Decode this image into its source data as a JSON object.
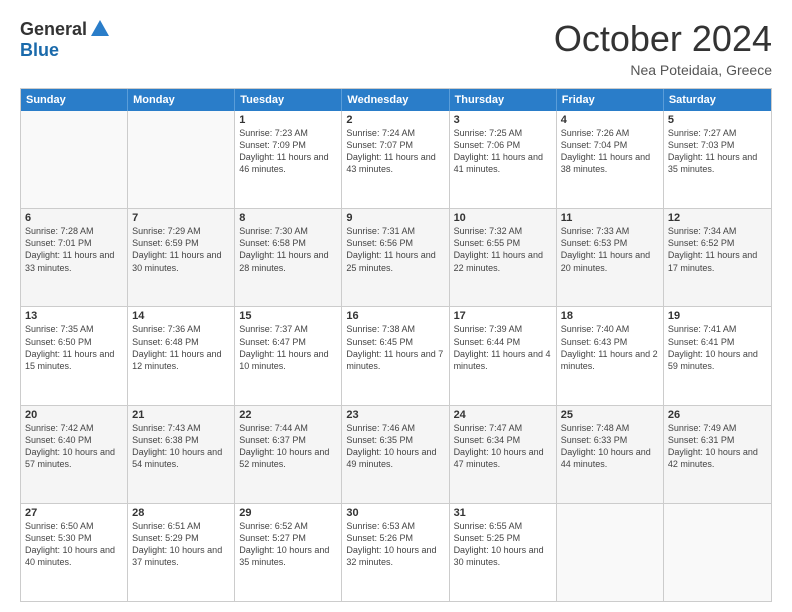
{
  "logo": {
    "general": "General",
    "blue": "Blue"
  },
  "title": "October 2024",
  "location": "Nea Poteidaia, Greece",
  "header_days": [
    "Sunday",
    "Monday",
    "Tuesday",
    "Wednesday",
    "Thursday",
    "Friday",
    "Saturday"
  ],
  "rows": [
    [
      {
        "day": "",
        "info": ""
      },
      {
        "day": "",
        "info": ""
      },
      {
        "day": "1",
        "info": "Sunrise: 7:23 AM\nSunset: 7:09 PM\nDaylight: 11 hours and 46 minutes."
      },
      {
        "day": "2",
        "info": "Sunrise: 7:24 AM\nSunset: 7:07 PM\nDaylight: 11 hours and 43 minutes."
      },
      {
        "day": "3",
        "info": "Sunrise: 7:25 AM\nSunset: 7:06 PM\nDaylight: 11 hours and 41 minutes."
      },
      {
        "day": "4",
        "info": "Sunrise: 7:26 AM\nSunset: 7:04 PM\nDaylight: 11 hours and 38 minutes."
      },
      {
        "day": "5",
        "info": "Sunrise: 7:27 AM\nSunset: 7:03 PM\nDaylight: 11 hours and 35 minutes."
      }
    ],
    [
      {
        "day": "6",
        "info": "Sunrise: 7:28 AM\nSunset: 7:01 PM\nDaylight: 11 hours and 33 minutes."
      },
      {
        "day": "7",
        "info": "Sunrise: 7:29 AM\nSunset: 6:59 PM\nDaylight: 11 hours and 30 minutes."
      },
      {
        "day": "8",
        "info": "Sunrise: 7:30 AM\nSunset: 6:58 PM\nDaylight: 11 hours and 28 minutes."
      },
      {
        "day": "9",
        "info": "Sunrise: 7:31 AM\nSunset: 6:56 PM\nDaylight: 11 hours and 25 minutes."
      },
      {
        "day": "10",
        "info": "Sunrise: 7:32 AM\nSunset: 6:55 PM\nDaylight: 11 hours and 22 minutes."
      },
      {
        "day": "11",
        "info": "Sunrise: 7:33 AM\nSunset: 6:53 PM\nDaylight: 11 hours and 20 minutes."
      },
      {
        "day": "12",
        "info": "Sunrise: 7:34 AM\nSunset: 6:52 PM\nDaylight: 11 hours and 17 minutes."
      }
    ],
    [
      {
        "day": "13",
        "info": "Sunrise: 7:35 AM\nSunset: 6:50 PM\nDaylight: 11 hours and 15 minutes."
      },
      {
        "day": "14",
        "info": "Sunrise: 7:36 AM\nSunset: 6:48 PM\nDaylight: 11 hours and 12 minutes."
      },
      {
        "day": "15",
        "info": "Sunrise: 7:37 AM\nSunset: 6:47 PM\nDaylight: 11 hours and 10 minutes."
      },
      {
        "day": "16",
        "info": "Sunrise: 7:38 AM\nSunset: 6:45 PM\nDaylight: 11 hours and 7 minutes."
      },
      {
        "day": "17",
        "info": "Sunrise: 7:39 AM\nSunset: 6:44 PM\nDaylight: 11 hours and 4 minutes."
      },
      {
        "day": "18",
        "info": "Sunrise: 7:40 AM\nSunset: 6:43 PM\nDaylight: 11 hours and 2 minutes."
      },
      {
        "day": "19",
        "info": "Sunrise: 7:41 AM\nSunset: 6:41 PM\nDaylight: 10 hours and 59 minutes."
      }
    ],
    [
      {
        "day": "20",
        "info": "Sunrise: 7:42 AM\nSunset: 6:40 PM\nDaylight: 10 hours and 57 minutes."
      },
      {
        "day": "21",
        "info": "Sunrise: 7:43 AM\nSunset: 6:38 PM\nDaylight: 10 hours and 54 minutes."
      },
      {
        "day": "22",
        "info": "Sunrise: 7:44 AM\nSunset: 6:37 PM\nDaylight: 10 hours and 52 minutes."
      },
      {
        "day": "23",
        "info": "Sunrise: 7:46 AM\nSunset: 6:35 PM\nDaylight: 10 hours and 49 minutes."
      },
      {
        "day": "24",
        "info": "Sunrise: 7:47 AM\nSunset: 6:34 PM\nDaylight: 10 hours and 47 minutes."
      },
      {
        "day": "25",
        "info": "Sunrise: 7:48 AM\nSunset: 6:33 PM\nDaylight: 10 hours and 44 minutes."
      },
      {
        "day": "26",
        "info": "Sunrise: 7:49 AM\nSunset: 6:31 PM\nDaylight: 10 hours and 42 minutes."
      }
    ],
    [
      {
        "day": "27",
        "info": "Sunrise: 6:50 AM\nSunset: 5:30 PM\nDaylight: 10 hours and 40 minutes."
      },
      {
        "day": "28",
        "info": "Sunrise: 6:51 AM\nSunset: 5:29 PM\nDaylight: 10 hours and 37 minutes."
      },
      {
        "day": "29",
        "info": "Sunrise: 6:52 AM\nSunset: 5:27 PM\nDaylight: 10 hours and 35 minutes."
      },
      {
        "day": "30",
        "info": "Sunrise: 6:53 AM\nSunset: 5:26 PM\nDaylight: 10 hours and 32 minutes."
      },
      {
        "day": "31",
        "info": "Sunrise: 6:55 AM\nSunset: 5:25 PM\nDaylight: 10 hours and 30 minutes."
      },
      {
        "day": "",
        "info": ""
      },
      {
        "day": "",
        "info": ""
      }
    ]
  ]
}
